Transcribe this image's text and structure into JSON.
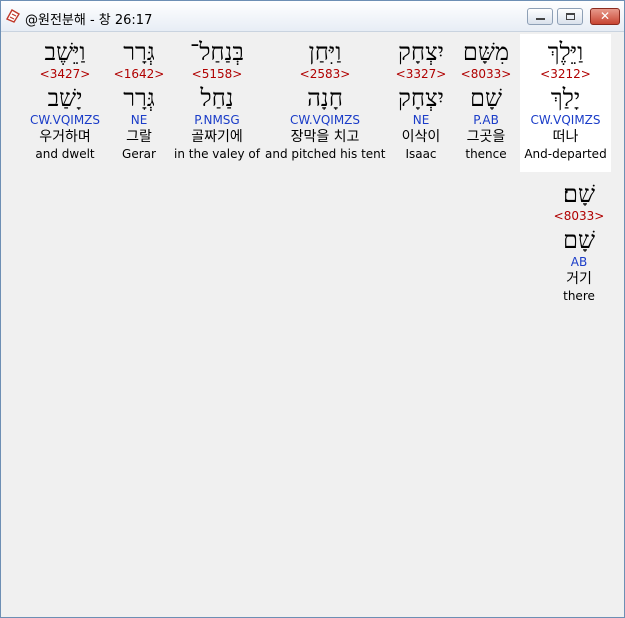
{
  "window": {
    "title": "@원전분해 - 창 26:17",
    "minimize_glyph": "",
    "maximize_glyph": "",
    "close_glyph": "✕"
  },
  "words": [
    {
      "hebrew": "וַיֵּלֶךְ",
      "strong": "<3212>",
      "lemma": "יָלַךְ",
      "morph": "CW.VQIMZS",
      "korean": "떠나",
      "english": "And-departed"
    },
    {
      "hebrew": "מִשָּׁם",
      "strong": "<8033>",
      "lemma": "שָׁם",
      "morph": "P.AB",
      "korean": "그곳을",
      "english": "thence"
    },
    {
      "hebrew": "יִצְחָק",
      "strong": "<3327>",
      "lemma": "יִצְחָק",
      "morph": "NE",
      "korean": "이삭이",
      "english": "Isaac"
    },
    {
      "hebrew": "וַיִּחַן",
      "strong": "<2583>",
      "lemma": "חָנָה",
      "morph": "CW.VQIMZS",
      "korean": "장막을 치고",
      "english": "and pitched his tent"
    },
    {
      "hebrew": "בְּנַחַל־",
      "strong": "<5158>",
      "lemma": "נַחַל",
      "morph": "P.NMSG",
      "korean": "골짜기에",
      "english": "in the valey of"
    },
    {
      "hebrew": "גְּרָר",
      "strong": "<1642>",
      "lemma": "גְּרָר",
      "morph": "NE",
      "korean": "그랄",
      "english": "Gerar"
    },
    {
      "hebrew": "וַיֵּשֶׁב",
      "strong": "<3427>",
      "lemma": "יָשַׁב",
      "morph": "CW.VQIMZS",
      "korean": "우거하며",
      "english": "and dwelt"
    },
    {
      "hebrew": "שָׁם׃",
      "strong": "<8033>",
      "lemma": "שָׁם",
      "morph": "AB",
      "korean": "거기",
      "english": "there"
    }
  ]
}
